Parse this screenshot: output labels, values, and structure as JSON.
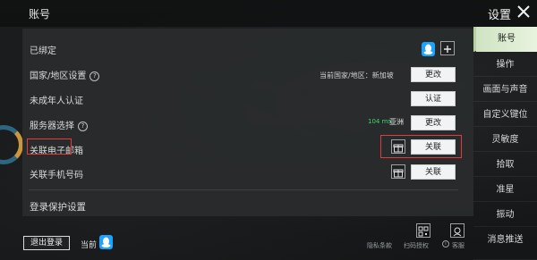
{
  "header": {
    "title": "账号",
    "settings_label": "设置",
    "close_icon": "close-icon"
  },
  "rows": {
    "bound": {
      "label": "已绑定"
    },
    "country": {
      "label": "国家/地区设置",
      "current_text": "当前国家/地区：新加坡",
      "button": "更改"
    },
    "minor": {
      "label": "未成年人认证",
      "button": "认证"
    },
    "server": {
      "label": "服务器选择",
      "ping": "104 ms",
      "region": "亚洲",
      "button": "更改"
    },
    "email": {
      "label": "关联电子邮箱",
      "button": "关联"
    },
    "phone": {
      "label": "关联手机号码",
      "button": "关联"
    },
    "login_protect": {
      "label": "登录保护设置"
    }
  },
  "bottom": {
    "logout_button": "退出登录",
    "current_label": "当前",
    "privacy_label": "隐私条款",
    "scan_label": "扫码授权",
    "support_label": "客服",
    "scan_icon": "qr-scan-icon",
    "support_icon": "customer-service-icon",
    "info_icon": "info-icon"
  },
  "sidebar": {
    "items": [
      {
        "label": "账号",
        "active": true
      },
      {
        "label": "操作"
      },
      {
        "label": "画面与声音"
      },
      {
        "label": "自定义键位"
      },
      {
        "label": "灵敏度"
      },
      {
        "label": "拾取"
      },
      {
        "label": "准星"
      },
      {
        "label": "振动"
      },
      {
        "label": "消息推送"
      }
    ]
  },
  "colors": {
    "accent_active": "#cfe3c2",
    "qq_blue": "#1aa3ff",
    "highlight_red": "#e23b3b",
    "ping_green": "#3fd36b"
  }
}
